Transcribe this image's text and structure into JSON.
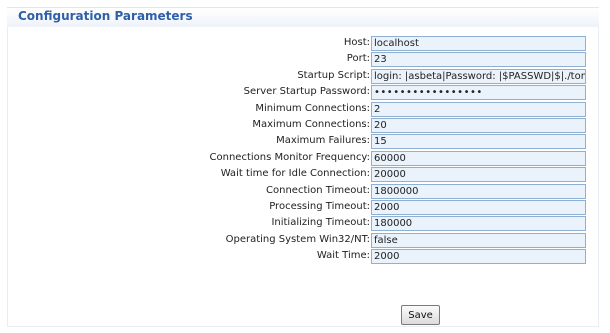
{
  "panel": {
    "title": "Configuration Parameters"
  },
  "fields": [
    {
      "label": "Host:",
      "value": "localhost",
      "type": "text"
    },
    {
      "label": "Port:",
      "value": "23",
      "type": "text"
    },
    {
      "label": "Startup Script:",
      "value": "login: |asbeta|Password: |$PASSWD|$|./tom",
      "type": "text"
    },
    {
      "label": "Server Startup Password:",
      "value": "•••••••••••••••••",
      "type": "password"
    },
    {
      "label": "Minimum Connections:",
      "value": "2",
      "type": "text"
    },
    {
      "label": "Maximum Connections:",
      "value": "20",
      "type": "text"
    },
    {
      "label": "Maximum Failures:",
      "value": "15",
      "type": "text"
    },
    {
      "label": "Connections Monitor Frequency:",
      "value": "60000",
      "type": "text"
    },
    {
      "label": "Wait time for Idle Connection:",
      "value": "20000",
      "type": "text"
    },
    {
      "label": "Connection Timeout:",
      "value": "1800000",
      "type": "text"
    },
    {
      "label": "Processing Timeout:",
      "value": "2000",
      "type": "text"
    },
    {
      "label": "Initializing Timeout:",
      "value": "180000",
      "type": "text"
    },
    {
      "label": "Operating System Win32/NT:",
      "value": "false",
      "type": "text"
    },
    {
      "label": "Wait Time:",
      "value": "2000",
      "type": "text"
    }
  ],
  "actions": {
    "save_label": "Save"
  },
  "colors": {
    "title": "#2f5fa8",
    "field_background": "#eaf2fb",
    "field_border": "#8fb0d0"
  }
}
